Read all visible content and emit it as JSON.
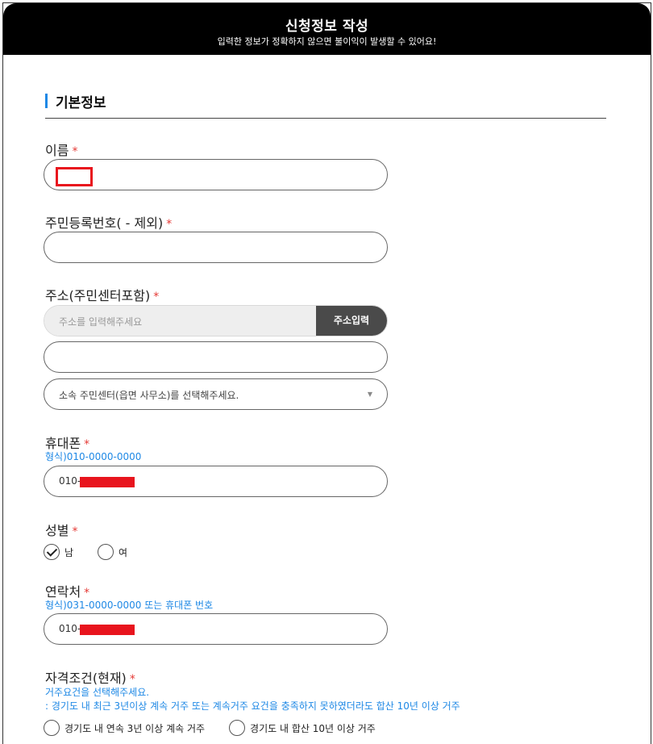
{
  "header": {
    "title": "신청정보 작성",
    "subtitle": "입력한 정보가 정확하지 않으면 불이익이 발생할 수 있어요!"
  },
  "section": {
    "title": "기본정보"
  },
  "fields": {
    "name": {
      "label": "이름",
      "required_mark": "*"
    },
    "resident_no": {
      "label": "주민등록번호( - 제외)",
      "required_mark": "*"
    },
    "address": {
      "label": "주소(주민센터포함)",
      "required_mark": "*",
      "placeholder": "주소를 입력해주세요",
      "button": "주소입력",
      "center_select": "소속 주민센터(읍면 사무소)를 선택해주세요."
    },
    "mobile": {
      "label": "휴대폰",
      "required_mark": "*",
      "hint": "형식)010-0000-0000",
      "value_prefix": "010-"
    },
    "gender": {
      "label": "성별",
      "required_mark": "*",
      "options": [
        "남",
        "여"
      ],
      "selected": "남"
    },
    "contact": {
      "label": "연락처",
      "required_mark": "*",
      "hint": "형식)031-0000-0000 또는 휴대폰 번호",
      "value_prefix": "010-"
    },
    "qualification": {
      "label": "자격조건(현재)",
      "required_mark": "*",
      "hint1": "거주요건을 선택해주세요.",
      "hint2": ": 경기도 내 최근 3년이상 계속 거주 또는 계속거주 요건을 충족하지 못하였더라도 합산 10년 이상 거주",
      "options": [
        "경기도 내 연속 3년 이상 계속 거주",
        "경기도 내 합산 10년 이상 거주"
      ]
    }
  },
  "colors": {
    "accent": "#1e88e5",
    "required": "#e53935",
    "redaction": "#e8141d",
    "header_bg": "#000000"
  }
}
